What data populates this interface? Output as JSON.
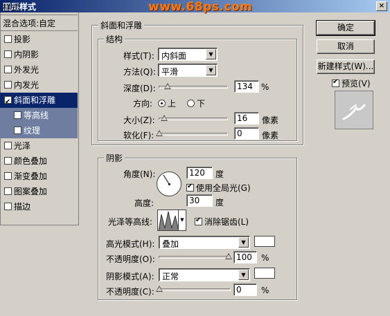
{
  "window": {
    "title": "图层样式",
    "watermark": "www.68ps.com",
    "close_label": "×"
  },
  "left_panel": {
    "header": "样式",
    "blend_options": "混合选项:自定",
    "items": [
      {
        "label": "投影",
        "checked": false
      },
      {
        "label": "内阴影",
        "checked": false
      },
      {
        "label": "外发光",
        "checked": false
      },
      {
        "label": "内发光",
        "checked": false
      },
      {
        "label": "斜面和浮雕",
        "checked": true,
        "selected": true
      },
      {
        "label": "等高线",
        "checked": false,
        "sub": true
      },
      {
        "label": "纹理",
        "checked": false,
        "sub": true
      },
      {
        "label": "光泽",
        "checked": false
      },
      {
        "label": "颜色叠加",
        "checked": false
      },
      {
        "label": "渐变叠加",
        "checked": false
      },
      {
        "label": "图案叠加",
        "checked": false
      },
      {
        "label": "描边",
        "checked": false
      }
    ]
  },
  "bevel": {
    "section_title": "斜面和浮雕",
    "structure_title": "结构",
    "style_label": "样式(T):",
    "style_value": "内斜面",
    "technique_label": "方法(Q):",
    "technique_value": "平滑",
    "depth_label": "深度(D):",
    "depth_value": "134",
    "depth_unit": "%",
    "depth_level_percent": 13.4,
    "direction_label": "方向:",
    "direction_up": "上",
    "direction_down": "下",
    "direction_selected": "上",
    "size_label": "大小(Z):",
    "size_value": "16",
    "size_unit": "像素",
    "soften_label": "软化(F):",
    "soften_value": "0",
    "soften_unit": "像素"
  },
  "shading": {
    "title": "阴影",
    "angle_label": "角度(N):",
    "angle_value": "120",
    "angle_unit": "度",
    "global_light_label": "使用全局光(G)",
    "global_light_checked": true,
    "altitude_label": "高度:",
    "altitude_value": "30",
    "altitude_unit": "度",
    "gloss_contour_label": "光泽等高线:",
    "antialias_label": "消除锯齿(L)",
    "antialias_checked": true,
    "highlight_mode_label": "高光模式(H):",
    "highlight_mode_value": "叠加",
    "highlight_color": "#ffffff",
    "highlight_opacity_label": "不透明度(O):",
    "highlight_opacity_value": "100",
    "shadow_mode_label": "阴影模式(A):",
    "shadow_mode_value": "正常",
    "shadow_color": "#ffffff",
    "shadow_opacity_label": "不透明度(C):",
    "shadow_opacity_value": "0",
    "percent_unit": "%"
  },
  "buttons": {
    "ok": "确定",
    "cancel": "取消",
    "new_style": "新建样式(W)...",
    "preview_label": "预览(V)",
    "preview_checked": true
  }
}
